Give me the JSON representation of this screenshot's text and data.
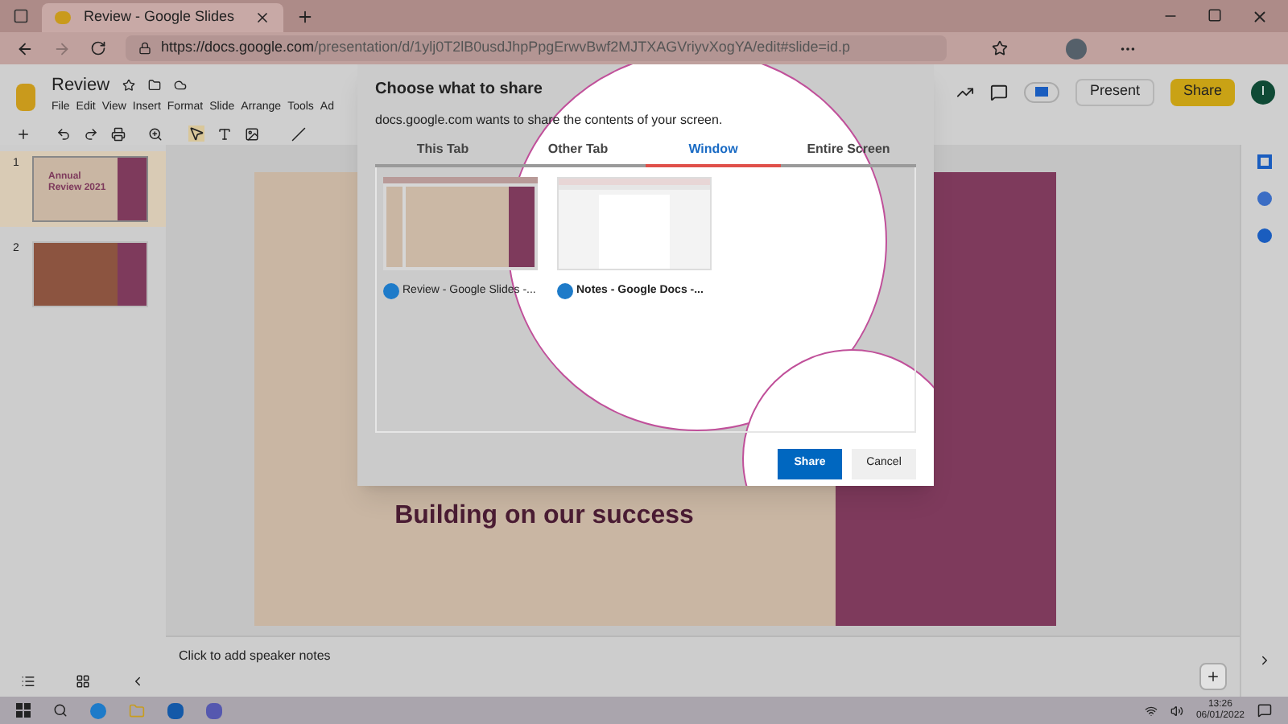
{
  "browser": {
    "tab_title": "Review - Google Slides",
    "url_host": "https://docs.google.com",
    "url_path": "/presentation/d/1ylj0T2lB0usdJhpPpgErwvBwf2MJTXAGVriyvXogYA/edit#slide=id.p"
  },
  "docs": {
    "title": "Review",
    "menus": [
      "File",
      "Edit",
      "View",
      "Insert",
      "Format",
      "Slide",
      "Arrange",
      "Tools",
      "Ad"
    ],
    "present": "Present",
    "share": "Share",
    "avatar": "I"
  },
  "slides": [
    {
      "number": "1",
      "selected": true,
      "title": "Annual Review 2021"
    },
    {
      "number": "2",
      "selected": false
    }
  ],
  "slide_title": "Building on our success",
  "speaker_notes": {
    "placeholder": "Click to add speaker notes"
  },
  "dialog": {
    "title": "Choose what to share",
    "subtitle": "docs.google.com wants to share the contents of your screen.",
    "tabs": [
      {
        "label": "This Tab",
        "selected": false
      },
      {
        "label": "Other Tab",
        "selected": false
      },
      {
        "label": "Window",
        "selected": true
      },
      {
        "label": "Entire Screen",
        "selected": false
      }
    ],
    "windows": [
      {
        "label": "Review - Google Slides -...",
        "selected": false,
        "kind": "slides"
      },
      {
        "label": "Notes - Google Docs -...",
        "selected": true,
        "kind": "docs"
      }
    ],
    "buttons": [
      {
        "label": "Share",
        "kind": "primary"
      },
      {
        "label": "Cancel",
        "kind": "secondary"
      }
    ]
  },
  "taskbar": {
    "time": "13:26",
    "date": "06/01/2022"
  }
}
